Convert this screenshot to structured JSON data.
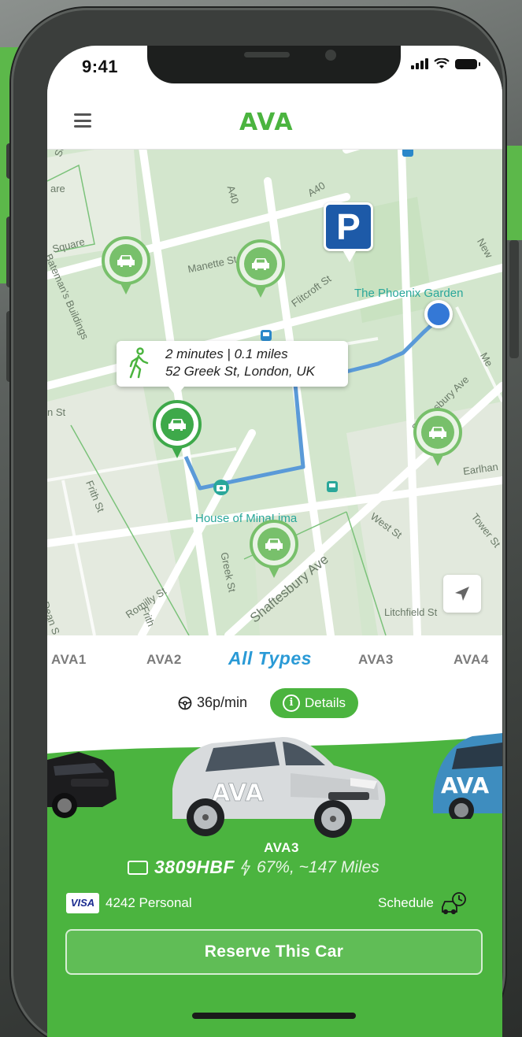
{
  "status_bar": {
    "time": "9:41"
  },
  "header": {
    "logo": "AVA"
  },
  "map": {
    "street_labels": [
      "Square",
      "are",
      "Square",
      "Bateman's Buildings",
      "A40",
      "A40",
      "Manette St",
      "Flitcroft St",
      "New",
      "Shaftesbury Ave",
      "Me",
      "Earlhan",
      "n St",
      "Frith St",
      "Greek St",
      "Romilly St",
      "Shaftesbury Ave",
      "West St",
      "Tower St",
      "Litchfield St",
      "Dean S",
      "Frith"
    ],
    "poi": {
      "garden": "The Phoenix Garden",
      "museum": "House of MinaLima"
    },
    "parking_label": "P",
    "tooltip": {
      "line1": "2 minutes | 0.1 miles",
      "line2": "52 Greek St, London, UK"
    }
  },
  "tabs": [
    {
      "label": "AVA1",
      "active": false
    },
    {
      "label": "AVA2",
      "active": false
    },
    {
      "label": "All Types",
      "active": true
    },
    {
      "label": "AVA3",
      "active": false
    },
    {
      "label": "AVA4",
      "active": false
    }
  ],
  "pricing": {
    "rate": "36p/min",
    "details_label": "Details"
  },
  "car": {
    "model": "AVA3",
    "plate": "3809HBF",
    "charge": "67%, ~147 Miles",
    "body_logo": "AVA"
  },
  "payment": {
    "card_brand": "VISA",
    "card_label": "4242 Personal",
    "schedule_label": "Schedule"
  },
  "actions": {
    "reserve_label": "Reserve This Car"
  },
  "colors": {
    "brand_green": "#4bb43f",
    "active_tab_blue": "#2a9ad6",
    "route_blue": "#5a9ad8",
    "parking_blue": "#1d5aa8"
  }
}
